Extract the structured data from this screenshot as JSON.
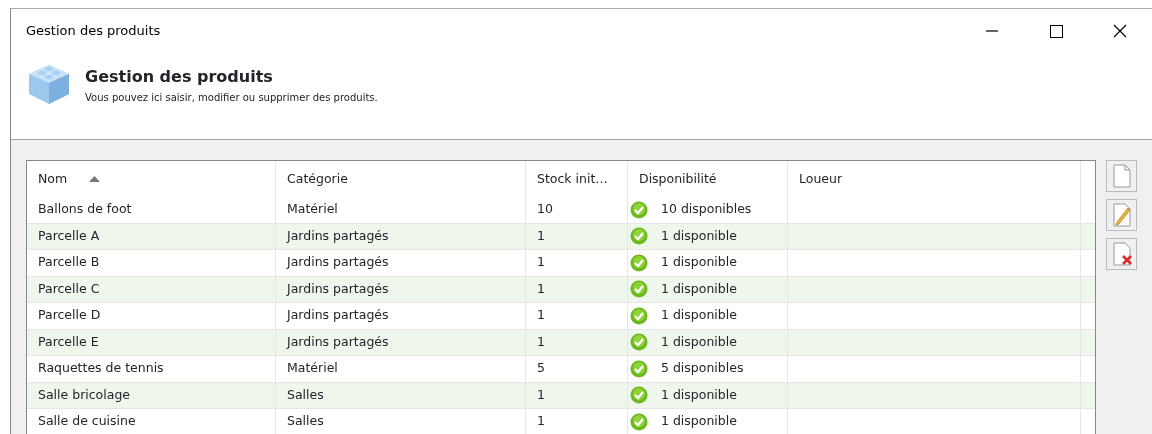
{
  "window": {
    "title": "Gestion des produits"
  },
  "header": {
    "title": "Gestion des produits",
    "subtitle": "Vous pouvez ici saisir, modifier ou supprimer des produits."
  },
  "table": {
    "columns": [
      {
        "label": "Nom",
        "sorted": true
      },
      {
        "label": "Catégorie",
        "sorted": false
      },
      {
        "label": "Stock init…",
        "sorted": false
      },
      {
        "label": "Disponibilité",
        "sorted": false
      },
      {
        "label": "Loueur",
        "sorted": false
      }
    ],
    "rows": [
      {
        "nom": "Ballons de foot",
        "categorie": "Matériel",
        "stock": "10",
        "disponibilite": "10 disponibles",
        "available": true
      },
      {
        "nom": "Parcelle A",
        "categorie": "Jardins partagés",
        "stock": "1",
        "disponibilite": "1 disponible",
        "available": true
      },
      {
        "nom": "Parcelle B",
        "categorie": "Jardins partagés",
        "stock": "1",
        "disponibilite": "1 disponible",
        "available": true
      },
      {
        "nom": "Parcelle C",
        "categorie": "Jardins partagés",
        "stock": "1",
        "disponibilite": "1 disponible",
        "available": true
      },
      {
        "nom": "Parcelle D",
        "categorie": "Jardins partagés",
        "stock": "1",
        "disponibilite": "1 disponible",
        "available": true
      },
      {
        "nom": "Parcelle E",
        "categorie": "Jardins partagés",
        "stock": "1",
        "disponibilite": "1 disponible",
        "available": true
      },
      {
        "nom": "Raquettes de tennis",
        "categorie": "Matériel",
        "stock": "5",
        "disponibilite": "5 disponibles",
        "available": true
      },
      {
        "nom": "Salle bricolage",
        "categorie": "Salles",
        "stock": "1",
        "disponibilite": "1 disponible",
        "available": true
      },
      {
        "nom": "Salle de cuisine",
        "categorie": "Salles",
        "stock": "1",
        "disponibilite": "1 disponible",
        "available": true
      }
    ]
  },
  "side_buttons": [
    {
      "kind": "new"
    },
    {
      "kind": "edit"
    },
    {
      "kind": "delete"
    }
  ]
}
